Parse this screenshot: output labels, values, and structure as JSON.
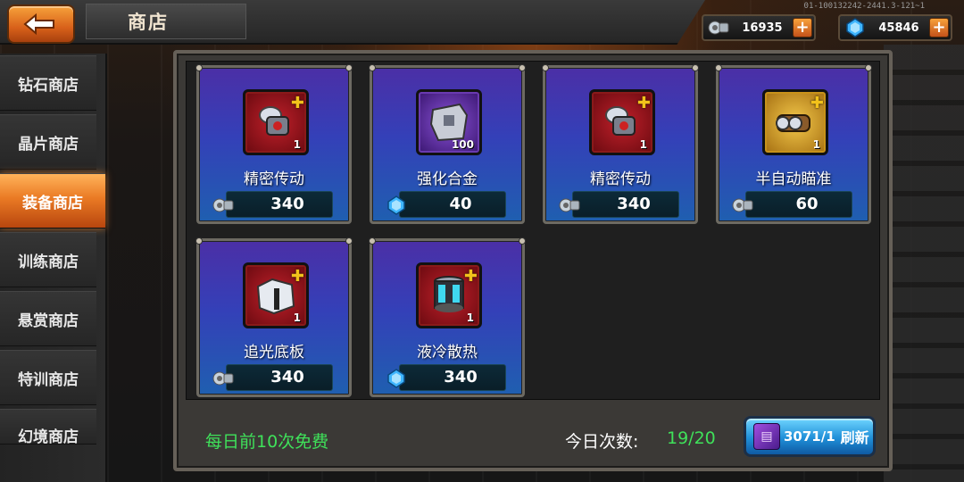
{
  "header": {
    "title": "商店",
    "version": "01-100132242-2441.3-121~1",
    "currencies": [
      {
        "name": "parts",
        "icon": "gear-parts-icon",
        "value": "16935"
      },
      {
        "name": "crystal",
        "icon": "blue-crystal-icon",
        "value": "45846"
      }
    ],
    "plus": "+"
  },
  "sidebar": {
    "items": [
      {
        "label": "钻石商店",
        "active": false
      },
      {
        "label": "晶片商店",
        "active": false
      },
      {
        "label": "装备商店",
        "active": true
      },
      {
        "label": "训练商店",
        "active": false
      },
      {
        "label": "悬赏商店",
        "active": false
      },
      {
        "label": "特训商店",
        "active": false
      },
      {
        "label": "幻境商店",
        "active": false
      }
    ]
  },
  "items": [
    {
      "name": "精密传动",
      "qty": "1",
      "price": "340",
      "currency_icon": "gear-parts-icon",
      "icon": "precision-drive-icon",
      "frame": "red"
    },
    {
      "name": "强化合金",
      "qty": "100",
      "price": "40",
      "currency_icon": "blue-crystal-icon",
      "icon": "alloy-icon",
      "frame": "purple"
    },
    {
      "name": "精密传动",
      "qty": "1",
      "price": "340",
      "currency_icon": "gear-parts-icon",
      "icon": "precision-drive-icon",
      "frame": "red"
    },
    {
      "name": "半自动瞄准",
      "qty": "1",
      "price": "60",
      "currency_icon": "gear-parts-icon",
      "icon": "semi-auto-aim-icon",
      "frame": "gold"
    },
    {
      "name": "追光底板",
      "qty": "1",
      "price": "340",
      "currency_icon": "gear-parts-icon",
      "icon": "base-plate-icon",
      "frame": "red"
    },
    {
      "name": "液冷散热",
      "qty": "1",
      "price": "340",
      "currency_icon": "blue-crystal-icon",
      "icon": "liquid-cooling-icon",
      "frame": "red"
    }
  ],
  "footer": {
    "free_note": "每日前10次免费",
    "count_label": "今日次数:",
    "count_value": "19/20",
    "refresh_cost": "3071/1",
    "refresh_label": "刷新"
  }
}
